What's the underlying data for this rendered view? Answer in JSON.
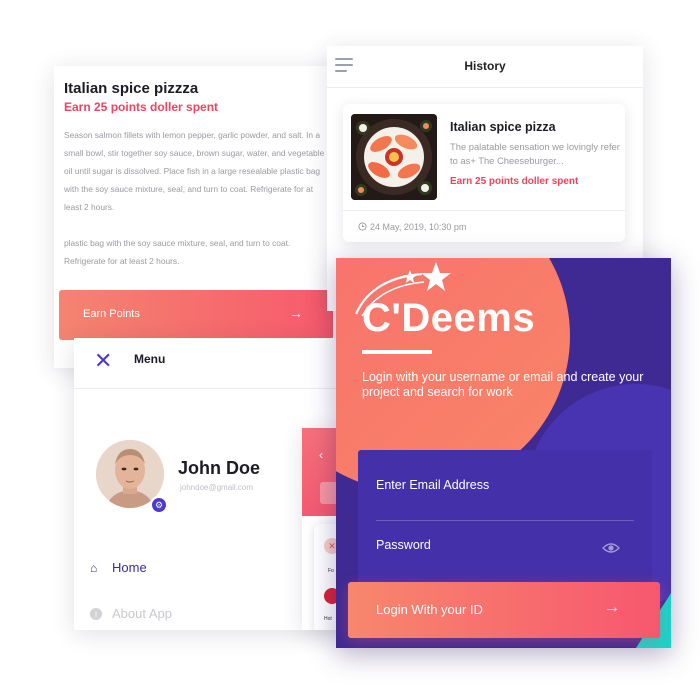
{
  "detail": {
    "title": "Italian spice pizzza",
    "points": "Earn 25 points doller spent",
    "paragraph1": "Season salmon fillets with lemon pepper, garlic powder, and salt. In a small bowl, stir together soy sauce, brown sugar, water, and vegetable oil until sugar is dissolved. Place fish in a large resealable plastic bag with the soy sauce mixture, seal, and turn to coat. Refrigerate for at least 2 hours.",
    "paragraph2": "plastic bag with the soy sauce mixture, seal, and turn to coat. Refrigerate for at least 2 hours.",
    "button_label": "Earn Points",
    "button_arrow": "→"
  },
  "history": {
    "title": "History",
    "item": {
      "title": "Italian spice pizza",
      "description": "The palatable sensation we lovingly refer to as+ The Cheeseburger...",
      "points": "Earn 25 points doller spent",
      "date": "24 May, 2019, 10:30 pm"
    }
  },
  "menu": {
    "close_glyph": "✕",
    "title": "Menu",
    "user_name": "John Doe",
    "user_email": "johndoe@gmail.com",
    "gear_glyph": "⚙",
    "nav_home_icon": "⌂",
    "nav_home": "Home",
    "nav_about_icon": "i",
    "nav_about": "About App"
  },
  "peek": {
    "back_glyph": "‹",
    "cat1_icon": "✕",
    "cat1_label": "Fo",
    "cat2_label": "Hot"
  },
  "login": {
    "brand": "C'Deems",
    "tagline": "Login with your username or email and create your project and search for work",
    "email_placeholder": "Enter Email Address",
    "password_placeholder": "Password",
    "button_label": "Login With your ID",
    "button_arrow": "→"
  },
  "colors": {
    "accent_red": "#ef4461",
    "brand_purple": "#3e2a92",
    "button_gradient_start": "#f7876d",
    "button_gradient_end": "#f7576e",
    "teal_accent": "#17d4c9"
  },
  "icons": [
    "hamburger-icon",
    "clock-icon",
    "close-icon",
    "gear-icon",
    "home-icon",
    "info-icon",
    "eye-icon",
    "arrow-right-icon",
    "star-icon",
    "chevron-left-icon"
  ]
}
